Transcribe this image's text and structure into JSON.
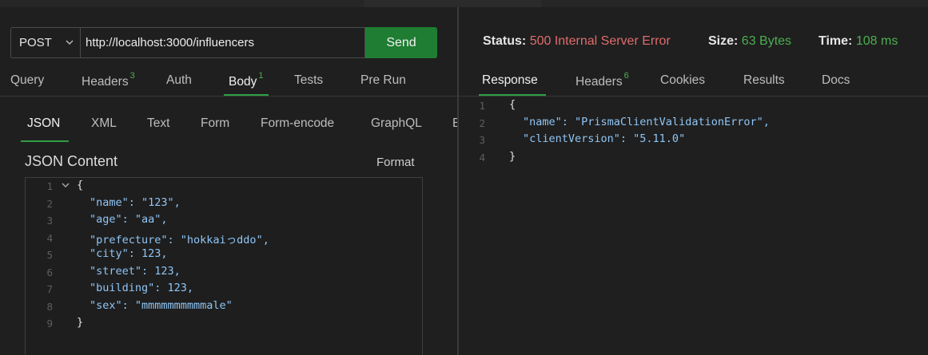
{
  "request": {
    "method": "POST",
    "url": "http://localhost:3000/influencers",
    "send_label": "Send",
    "tabs": [
      {
        "label": "Query",
        "count": ""
      },
      {
        "label": "Headers",
        "count": "3"
      },
      {
        "label": "Auth",
        "count": ""
      },
      {
        "label": "Body",
        "count": "1"
      },
      {
        "label": "Tests",
        "count": ""
      },
      {
        "label": "Pre Run",
        "count": ""
      }
    ],
    "active_tab": "Body",
    "body_tabs": [
      "JSON",
      "XML",
      "Text",
      "Form",
      "Form-encode",
      "GraphQL",
      "B"
    ],
    "active_body_tab": "JSON",
    "content_label": "JSON Content",
    "format_label": "Format",
    "line_numbers": [
      "1",
      "2",
      "3",
      "4",
      "5",
      "6",
      "7",
      "8",
      "9"
    ],
    "body_lines": [
      "{",
      "\"name\": \"123\",",
      "\"age\": \"aa\",",
      "\"prefecture\": \"hokkaiっddo\",",
      "\"city\": 123,",
      "\"street\": 123,",
      "\"building\": 123,",
      "\"sex\": \"mmmmmmmmmmale\"",
      "}"
    ]
  },
  "response": {
    "status_label": "Status:",
    "status_value": "500 Internal Server Error",
    "size_label": "Size:",
    "size_value": "63 Bytes",
    "time_label": "Time:",
    "time_value": "108 ms",
    "tabs": [
      {
        "label": "Response",
        "count": ""
      },
      {
        "label": "Headers",
        "count": "6"
      },
      {
        "label": "Cookies",
        "count": ""
      },
      {
        "label": "Results",
        "count": ""
      },
      {
        "label": "Docs",
        "count": ""
      }
    ],
    "active_tab": "Response",
    "line_numbers": [
      "1",
      "2",
      "3",
      "4"
    ],
    "body_lines": [
      "{",
      "\"name\": \"PrismaClientValidationError\",",
      "\"clientVersion\": \"5.11.0\"",
      "}"
    ]
  },
  "colors": {
    "accent_green": "#2f9e44",
    "send_button": "#1e7d32",
    "error_red": "#e06c6c",
    "ok_green": "#4caf50",
    "json_key": "#8fc5f6"
  },
  "icons": {
    "method_dropdown": "chevron-down-icon",
    "fold": "chevron-down-icon"
  }
}
